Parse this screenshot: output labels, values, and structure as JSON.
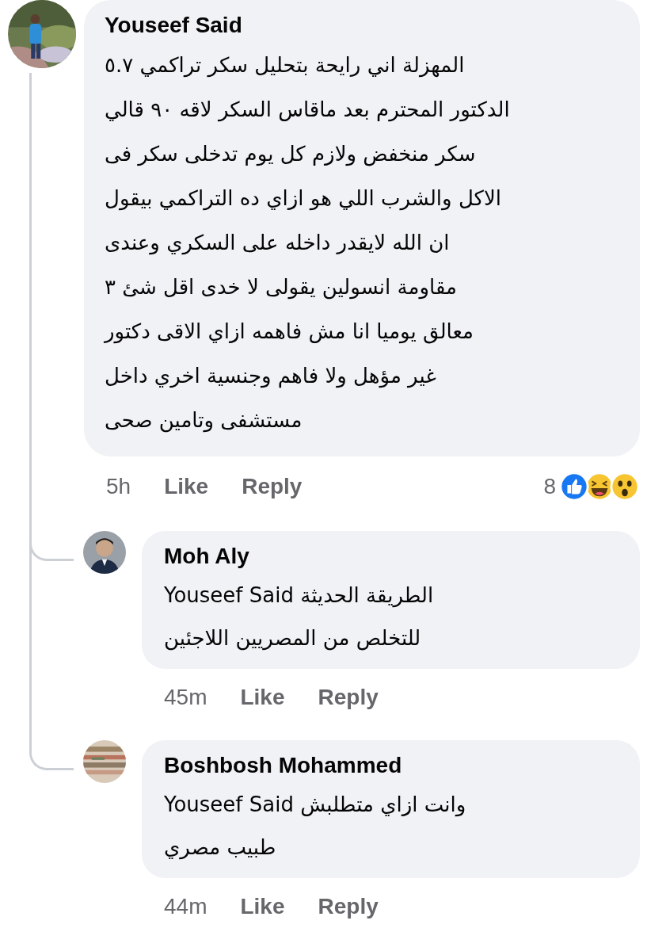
{
  "comment": {
    "author": "Youseef Said",
    "lines": [
      "المهزلة اني رايحة بتحليل سكر تراكمي ٥.٧",
      "الدكتور المحترم بعد ماقاس السكر لاقه ٩٠ قالي",
      "سكر منخفض ولازم كل يوم تدخلى سكر فى",
      "الاكل والشرب اللي هو ازاي ده التراكمي بيقول",
      "ان الله لايقدر داخله على السكري وعندى",
      "مقاومة انسولين يقولى لا خدى اقل شئ ٣",
      "معالق يوميا انا مش فاهمه ازاي الاقى دكتور",
      "غير مؤهل ولا فاهم وجنسية اخري داخل",
      "مستشفى وتامين صحى"
    ],
    "time": "5h",
    "like": "Like",
    "reply": "Reply",
    "reaction_count": "8",
    "replies": [
      {
        "author": "Moh Aly",
        "lines": [
          "الطريقة الحديثة Youseef Said",
          "للتخلص من المصريين اللاجئين"
        ],
        "time": "45m",
        "like": "Like",
        "reply": "Reply"
      },
      {
        "author": "Boshbosh Mohammed",
        "lines": [
          "وانت ازاي متطلبش Youseef Said",
          "طبيب مصري"
        ],
        "time": "44m",
        "like": "Like",
        "reply": "Reply"
      }
    ]
  }
}
